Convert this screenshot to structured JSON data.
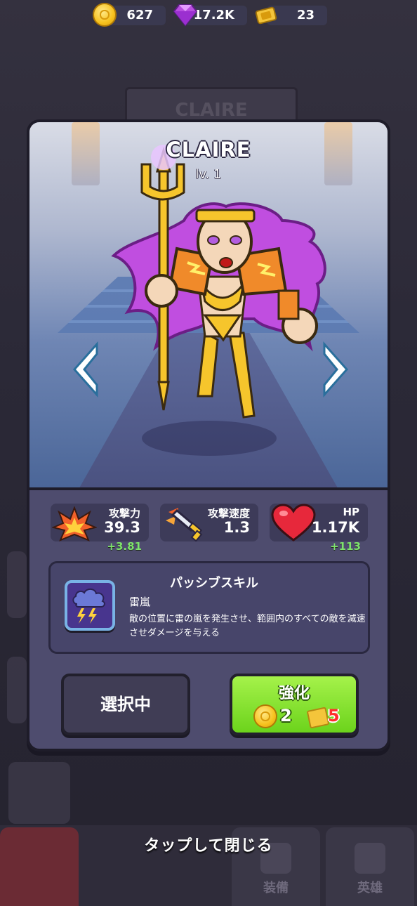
{
  "resources": {
    "coins": "627",
    "gems": "17.2K",
    "tickets": "23"
  },
  "background": {
    "title": "CLAIRE",
    "nav": {
      "equipment": "装備",
      "heroes": "英雄"
    }
  },
  "hero": {
    "name": "CLAIRE",
    "level": "lv. 1"
  },
  "stats": {
    "attack": {
      "label": "攻撃力",
      "value": "39.3",
      "bonus": "+3.81"
    },
    "speed": {
      "label": "攻撃速度",
      "value": "1.3"
    },
    "hp": {
      "label": "HP",
      "value": "1.17K",
      "bonus": "+113"
    }
  },
  "skill": {
    "title": "パッシブスキル",
    "name": "雷嵐",
    "description": "敵の位置に雷の嵐を発生させ、範囲内のすべての敵を減速させダメージを与える"
  },
  "buttons": {
    "selected": "選択中",
    "upgrade": "強化",
    "upgrade_coin_cost": "2",
    "upgrade_ticket_cost": "5"
  },
  "close_hint": "タップして閉じる",
  "colors": {
    "accent_green": "#7ee36c",
    "upgrade_button": "#6cd31c",
    "panel": "#4e4c6e"
  }
}
